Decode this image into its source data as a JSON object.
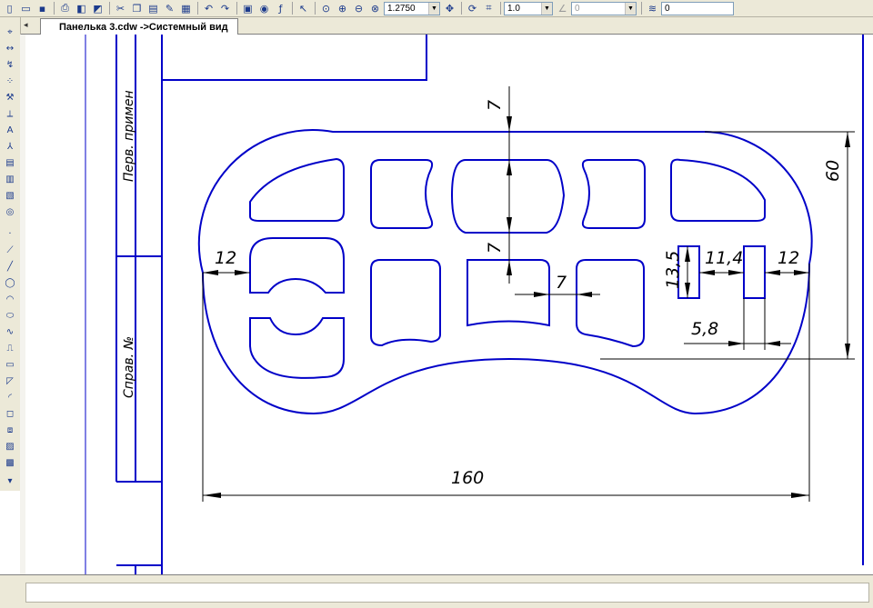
{
  "toolbar": {
    "icons": [
      "new-document-icon",
      "open-icon",
      "save-icon",
      "print-icon",
      "preview-icon",
      "copy-properties-icon",
      "cut-icon",
      "copy-icon",
      "paste-icon",
      "brush-icon",
      "table-icon",
      "undo-icon",
      "redo-icon",
      "manager-icon",
      "library-icon",
      "formula-icon",
      "help-pointer-icon",
      "zoom-fit-icon",
      "zoom-in-icon",
      "zoom-out-icon",
      "zoom-window-icon",
      "pan-icon",
      "refresh-icon",
      "snap-icon",
      "layers-icon"
    ],
    "zoom_value": "1.2750",
    "step_value": "1.0",
    "angle_value": "0",
    "layer_value": "0"
  },
  "tab": {
    "label": "Панелька 3.cdw ->Системный вид"
  },
  "stamp": {
    "field1": "Перв. примен",
    "field2": "Справ. №"
  },
  "dimensions": {
    "top_gap": "7",
    "middle_gap": "7",
    "inner_gap": "7",
    "left_margin": "12",
    "right_margin": "12",
    "slot_width": "11,4",
    "slot_height": "13,5",
    "slot_offset": "5,8",
    "overall_height": "60",
    "overall_width": "160"
  },
  "colors": {
    "geometry": "#0000c8",
    "dimension": "#000000",
    "ui_face": "#ece9d8"
  }
}
